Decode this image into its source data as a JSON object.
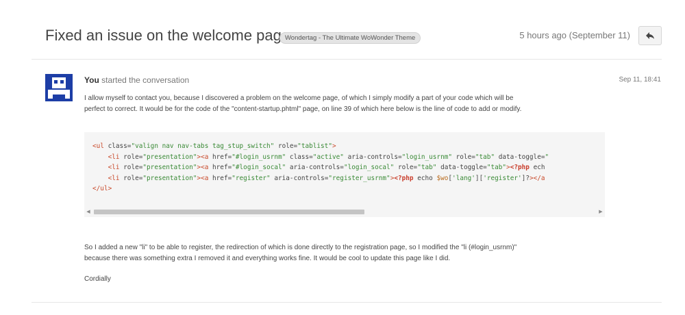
{
  "header": {
    "title": "Fixed an issue on the welcome page",
    "tag": "Wondertag - The Ultimate WoWonder Theme",
    "time": "5 hours ago (September 11)",
    "reply_icon": "reply-arrow-icon"
  },
  "message": {
    "author": "You",
    "action": "started the conversation",
    "date": "Sep 11, 18:41",
    "avatar_icon": "pixel-avatar-icon",
    "avatar_color": "#1d3ea6",
    "intro_line1": "I allow myself to contact you, because I discovered a problem on the welcome page, of which I simply modify a part of your code which will be",
    "intro_line2": "perfect to correct. It would be for the code of the \"content-startup.phtml\" page, on line 39 of which here below is the line of code to add or modify.",
    "code_lines": [
      "<ul class=\"valign nav nav-tabs tag_stup_switch\" role=\"tablist\">",
      "    <li role=\"presentation\"><a href=\"#login_usrnm\" class=\"active\" aria-controls=\"login_usrnm\" role=\"tab\" data-toggle=\"",
      "    <li role=\"presentation\"><a href=\"#login_socal\" aria-controls=\"login_socal\" role=\"tab\" data-toggle=\"tab\"><?php ech",
      "    <li role=\"presentation\"><a href=\"register\" aria-controls=\"register_usrnm\"><?php echo $wo['lang']['register']?></a",
      "</ul>"
    ],
    "outro_line1": "So I added a new \"li\" to be able to register, the redirection of which is done directly to the registration page, so I modified the \"li (#login_usrnm)\"",
    "outro_line2": "because there was something extra I removed it and everything works fine. It would be cool to update this page like I did.",
    "closing": "Cordially"
  }
}
